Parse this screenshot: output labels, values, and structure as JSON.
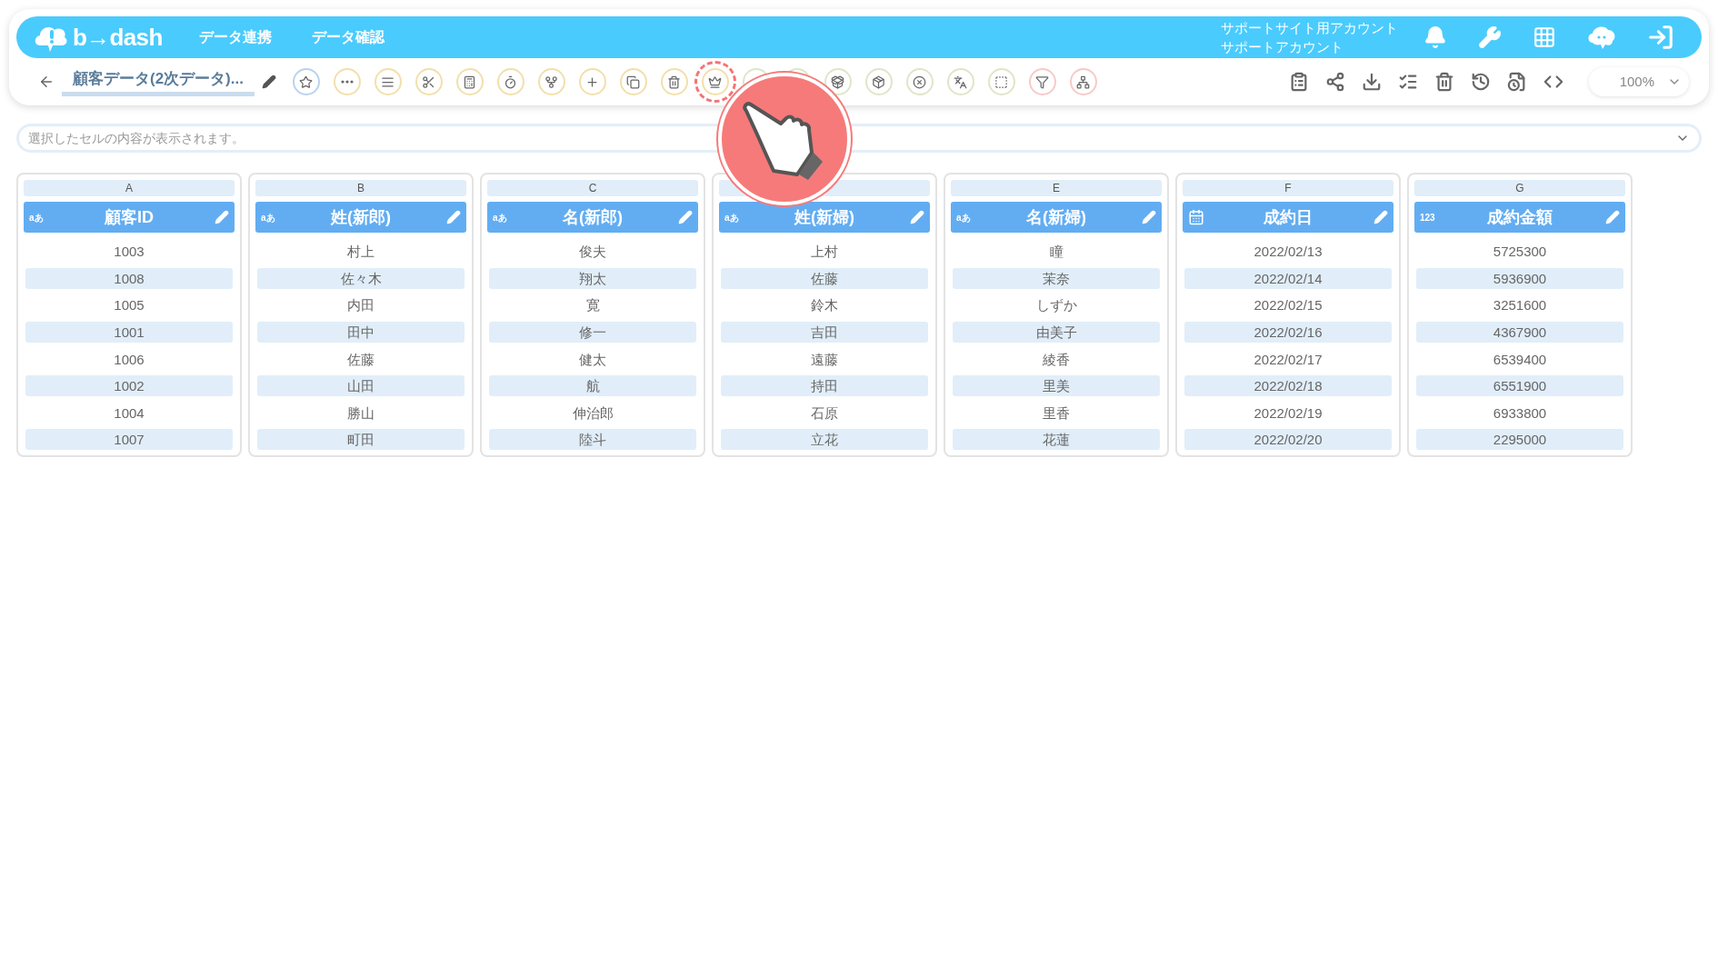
{
  "header": {
    "logo_text": "b→dash",
    "nav": [
      "データ連携",
      "データ確認"
    ],
    "account": [
      "サポートサイト用アカウント",
      "サポートアカウント"
    ]
  },
  "toolbar": {
    "title": "顧客データ(2次データ)...",
    "tools": [
      {
        "color": "#b9d3ee",
        "highlighted": false
      },
      {
        "color": "#f3dfaa",
        "highlighted": false
      },
      {
        "color": "#f3dfaa",
        "highlighted": false
      },
      {
        "color": "#f3dfaa",
        "highlighted": false
      },
      {
        "color": "#f3dfaa",
        "highlighted": false
      },
      {
        "color": "#f3dfaa",
        "highlighted": false
      },
      {
        "color": "#f3dfaa",
        "highlighted": false
      },
      {
        "color": "#f3dfaa",
        "highlighted": false
      },
      {
        "color": "#f3dfaa",
        "highlighted": false
      },
      {
        "color": "#f3dfaa",
        "highlighted": false
      },
      {
        "color": "#f3dfaa",
        "highlighted": true
      },
      {
        "color": "#dfe6c8",
        "highlighted": false
      },
      {
        "color": "#dfe6c8",
        "highlighted": false
      },
      {
        "color": "#dfe6c8",
        "highlighted": false
      },
      {
        "color": "#dfe6c8",
        "highlighted": false
      },
      {
        "color": "#dfe6c8",
        "highlighted": false
      },
      {
        "color": "#dfe6c8",
        "highlighted": false
      },
      {
        "color": "#dfe6c8",
        "highlighted": false
      },
      {
        "color": "#f8c9c9",
        "highlighted": false
      },
      {
        "color": "#f8c9c9",
        "highlighted": false
      }
    ],
    "zoom": "100%"
  },
  "cell_viewer": {
    "placeholder": "選択したセルの内容が表示されます。"
  },
  "table": {
    "columns": [
      {
        "letter": "A",
        "kind": "text",
        "type_label": "aあ",
        "name": "顧客ID",
        "cells": [
          "1003",
          "1008",
          "1005",
          "1001",
          "1006",
          "1002",
          "1004",
          "1007"
        ]
      },
      {
        "letter": "B",
        "kind": "text",
        "type_label": "aあ",
        "name": "姓(新郎)",
        "cells": [
          "村上",
          "佐々木",
          "内田",
          "田中",
          "佐藤",
          "山田",
          "勝山",
          "町田"
        ]
      },
      {
        "letter": "C",
        "kind": "text",
        "type_label": "aあ",
        "name": "名(新郎)",
        "cells": [
          "俊夫",
          "翔太",
          "寛",
          "修一",
          "健太",
          "航",
          "伸治郎",
          "陸斗"
        ]
      },
      {
        "kind": "text",
        "type_label": "aあ",
        "name": "姓(新婦)",
        "cells": [
          "上村",
          "佐藤",
          "鈴木",
          "吉田",
          "遠藤",
          "持田",
          "石原",
          "立花"
        ]
      },
      {
        "letter": "E",
        "kind": "text",
        "type_label": "aあ",
        "name": "名(新婦)",
        "cells": [
          "瞳",
          "茉奈",
          "しずか",
          "由美子",
          "綾香",
          "里美",
          "里香",
          "花蓮"
        ]
      },
      {
        "letter": "F",
        "kind": "date",
        "name": "成約日",
        "cells": [
          "2022/02/13",
          "2022/02/14",
          "2022/02/15",
          "2022/02/16",
          "2022/02/17",
          "2022/02/18",
          "2022/02/19",
          "2022/02/20"
        ]
      },
      {
        "letter": "G",
        "kind": "number",
        "type_label": "123",
        "name": "成約金額",
        "cells": [
          "5725300",
          "5936900",
          "3251600",
          "4367900",
          "6539400",
          "6551900",
          "6933800",
          "2295000"
        ]
      }
    ]
  }
}
